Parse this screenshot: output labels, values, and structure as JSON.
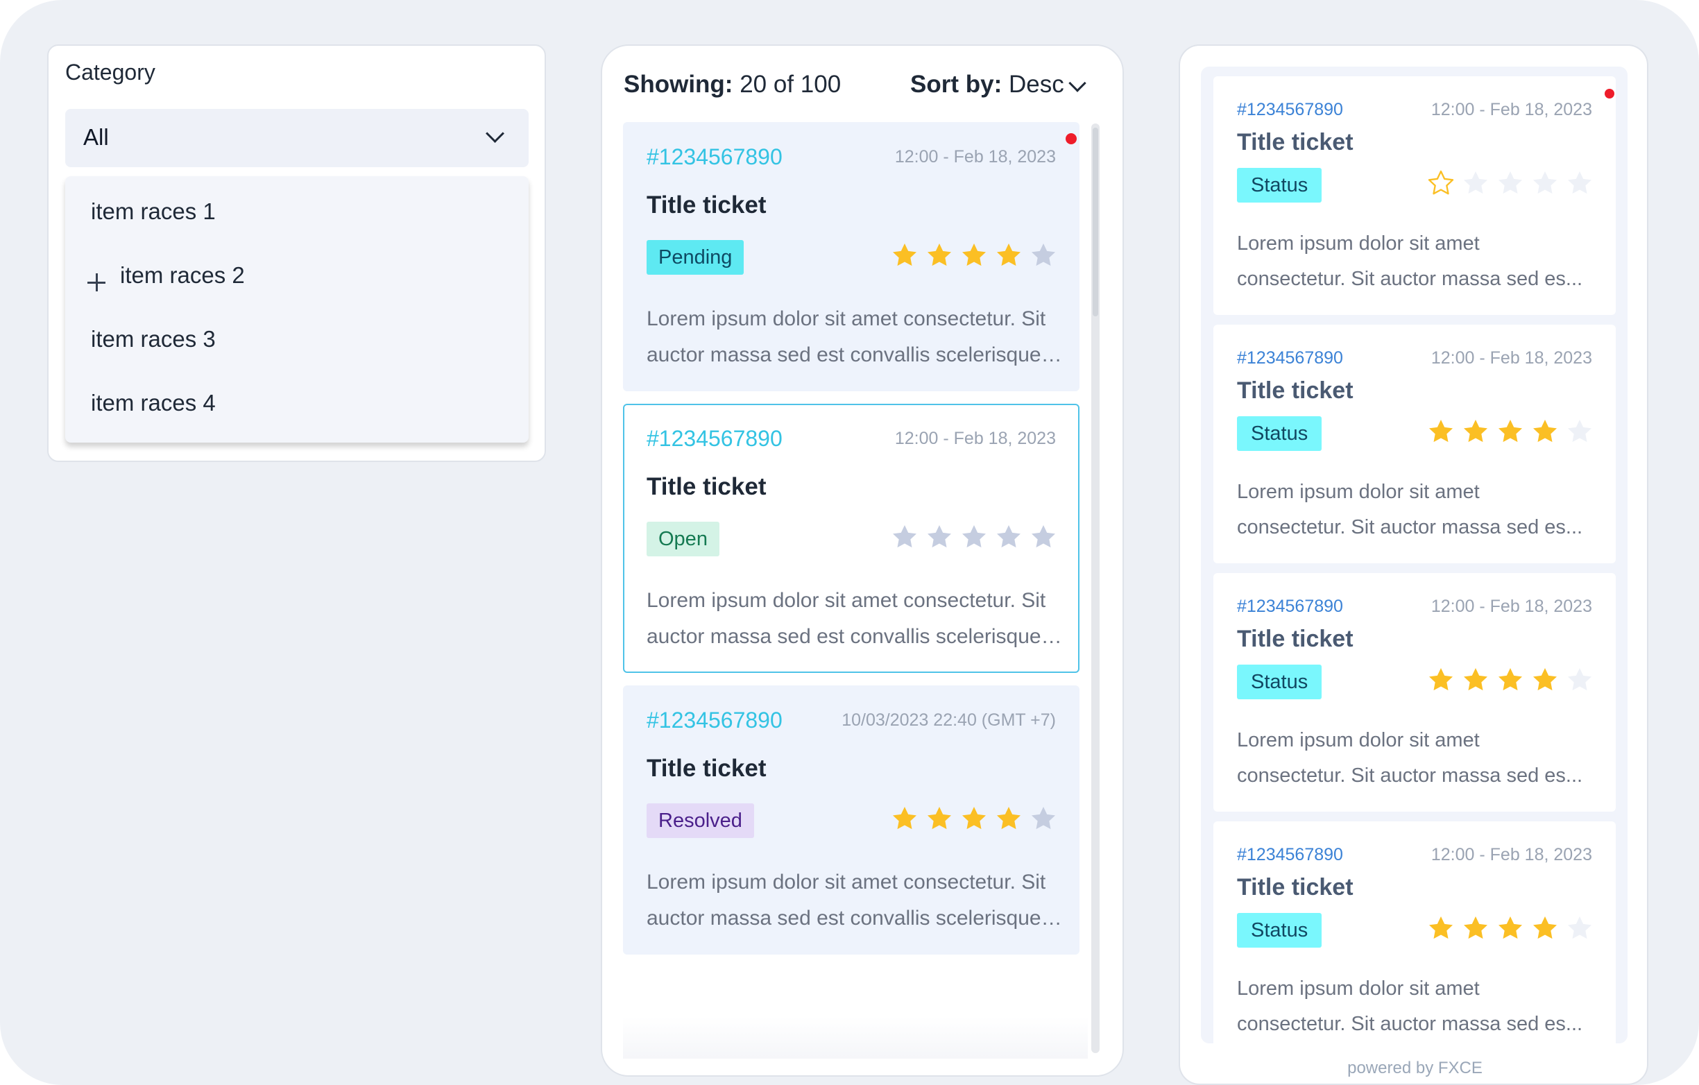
{
  "colors": {
    "accent_cyan": "#33c3e3",
    "star_filled": "#fbbf24",
    "star_empty": "#c5cde0",
    "notification": "#ee1c2a"
  },
  "category": {
    "label": "Category",
    "selected": "All",
    "options": [
      "item races 1",
      "item races 2",
      "item races 3",
      "item races 4"
    ]
  },
  "list": {
    "showing_label": "Showing:",
    "showing_value": "20 of 100",
    "sort_label": "Sort by:",
    "sort_value": "Desc",
    "tickets": [
      {
        "id": "#1234567890",
        "date": "12:00 - Feb 18, 2023",
        "title": "Title ticket",
        "status": "Pending",
        "rating": 4,
        "desc_line1": "Lorem ipsum dolor sit amet consectetur. Sit",
        "desc_line2": "auctor massa sed est convallis scelerisque c...",
        "unread": true
      },
      {
        "id": "#1234567890",
        "date": "12:00 - Feb 18, 2023",
        "title": "Title ticket",
        "status": "Open",
        "rating": 0,
        "desc_line1": "Lorem ipsum dolor sit amet consectetur. Sit",
        "desc_line2": "auctor massa sed est convallis scelerisque c...",
        "unread": false
      },
      {
        "id": "#1234567890",
        "date": "10/03/2023 22:40 (GMT +7)",
        "title": "Title ticket",
        "status": "Resolved",
        "rating": 4,
        "desc_line1": "Lorem ipsum dolor sit amet consectetur. Sit",
        "desc_line2": "auctor massa sed est convallis scelerisque c...",
        "unread": false
      }
    ]
  },
  "compact_list": {
    "tickets": [
      {
        "id": "#1234567890",
        "date": "12:00 - Feb 18, 2023",
        "title": "Title ticket",
        "status": "Status",
        "rating": 0,
        "desc_line1": "Lorem ipsum dolor sit amet",
        "desc_line2": "consectetur. Sit auctor massa sed es...",
        "unread": true
      },
      {
        "id": "#1234567890",
        "date": "12:00 - Feb 18, 2023",
        "title": "Title ticket",
        "status": "Status",
        "rating": 4,
        "desc_line1": "Lorem ipsum dolor sit amet",
        "desc_line2": "consectetur. Sit auctor massa sed es...",
        "unread": false
      },
      {
        "id": "#1234567890",
        "date": "12:00 - Feb 18, 2023",
        "title": "Title ticket",
        "status": "Status",
        "rating": 4,
        "desc_line1": "Lorem ipsum dolor sit amet",
        "desc_line2": "consectetur. Sit auctor massa sed es...",
        "unread": false
      },
      {
        "id": "#1234567890",
        "date": "12:00 - Feb 18, 2023",
        "title": "Title ticket",
        "status": "Status",
        "rating": 4,
        "desc_line1": "Lorem ipsum dolor sit amet",
        "desc_line2": "consectetur. Sit auctor massa sed es...",
        "unread": false
      }
    ],
    "footer": "powered by FXCE"
  }
}
